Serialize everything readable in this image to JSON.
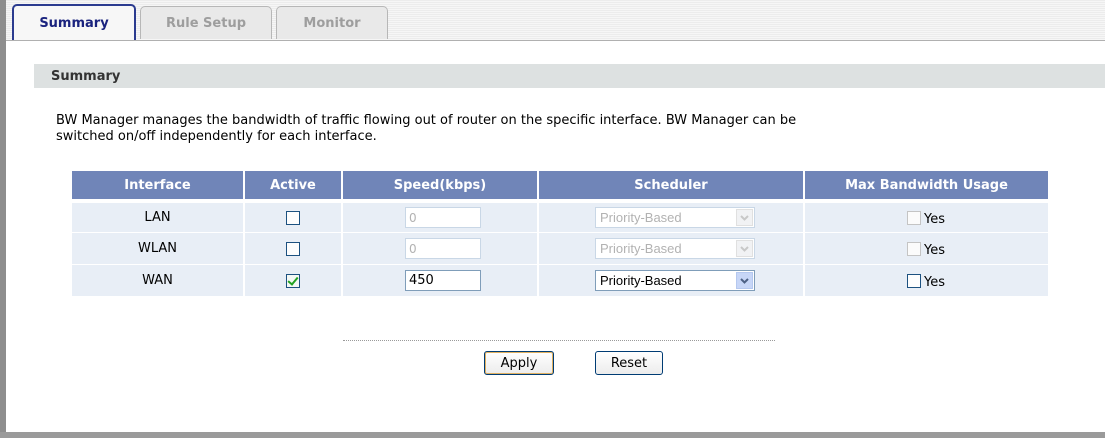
{
  "tabs": [
    {
      "label": "Summary",
      "active": true
    },
    {
      "label": "Rule Setup",
      "active": false
    },
    {
      "label": "Monitor",
      "active": false
    }
  ],
  "section_title": "Summary",
  "description_line1": "BW Manager manages the bandwidth of traffic flowing out of router on the specific interface. BW Manager can be",
  "description_line2": "switched on/off independently for each interface.",
  "table": {
    "headers": [
      "Interface",
      "Active",
      "Speed(kbps)",
      "Scheduler",
      "Max Bandwidth Usage"
    ],
    "rows": [
      {
        "interface": "LAN",
        "active": false,
        "speed": "0",
        "scheduler": "Priority-Based",
        "max_bw_label": "Yes",
        "max_bw": false,
        "enabled": false
      },
      {
        "interface": "WLAN",
        "active": false,
        "speed": "0",
        "scheduler": "Priority-Based",
        "max_bw_label": "Yes",
        "max_bw": false,
        "enabled": false
      },
      {
        "interface": "WAN",
        "active": true,
        "speed": "450",
        "scheduler": "Priority-Based",
        "max_bw_label": "Yes",
        "max_bw": false,
        "enabled": true
      }
    ]
  },
  "buttons": {
    "apply": "Apply",
    "reset": "Reset"
  },
  "colors": {
    "accent": "#2b3b8f",
    "header_bg": "#7085b8",
    "row_bg": "#e8eef6",
    "section_bg": "#dde1e1"
  }
}
